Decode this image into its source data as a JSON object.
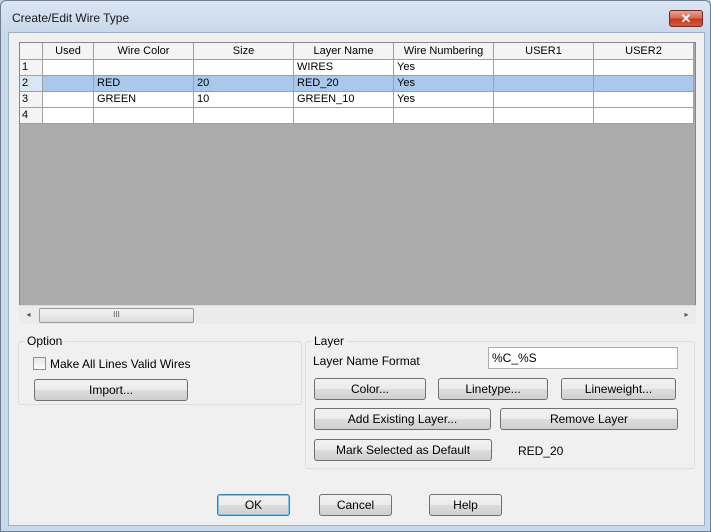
{
  "window": {
    "title": "Create/Edit Wire Type",
    "close_glyph": "✕"
  },
  "grid": {
    "columns": [
      "Used",
      "Wire Color",
      "Size",
      "Layer Name",
      "Wire Numbering",
      "USER1",
      "USER2"
    ],
    "rows": [
      {
        "num": "1",
        "cells": [
          "",
          "",
          "",
          "WIRES",
          "Yes",
          "",
          ""
        ]
      },
      {
        "num": "2",
        "cells": [
          "",
          "RED",
          "20",
          "RED_20",
          "Yes",
          "",
          ""
        ],
        "selected": true
      },
      {
        "num": "3",
        "cells": [
          "",
          "GREEN",
          "10",
          "GREEN_10",
          "Yes",
          "",
          ""
        ]
      },
      {
        "num": "4",
        "cells": [
          "",
          "",
          "",
          "",
          "",
          "",
          ""
        ]
      }
    ],
    "scroll_left": "◂",
    "scroll_right": "▸",
    "scroll_grip": "III"
  },
  "option": {
    "title": "Option",
    "make_all_valid_label": "Make All Lines Valid Wires",
    "make_all_valid_checked": false,
    "import_label": "Import..."
  },
  "layer": {
    "title": "Layer",
    "name_format_label": "Layer Name Format",
    "name_format_value": "%C_%S",
    "color_label": "Color...",
    "linetype_label": "Linetype...",
    "lineweight_label": "Lineweight...",
    "add_existing_label": "Add Existing Layer...",
    "remove_label": "Remove Layer",
    "mark_default_label": "Mark Selected as Default",
    "default_value": "RED_20"
  },
  "footer": {
    "ok_label": "OK",
    "cancel_label": "Cancel",
    "help_label": "Help"
  },
  "colors": {
    "selection": "#a9c8ec",
    "titlebar": "#c9d8eb",
    "close": "#c43b22"
  }
}
